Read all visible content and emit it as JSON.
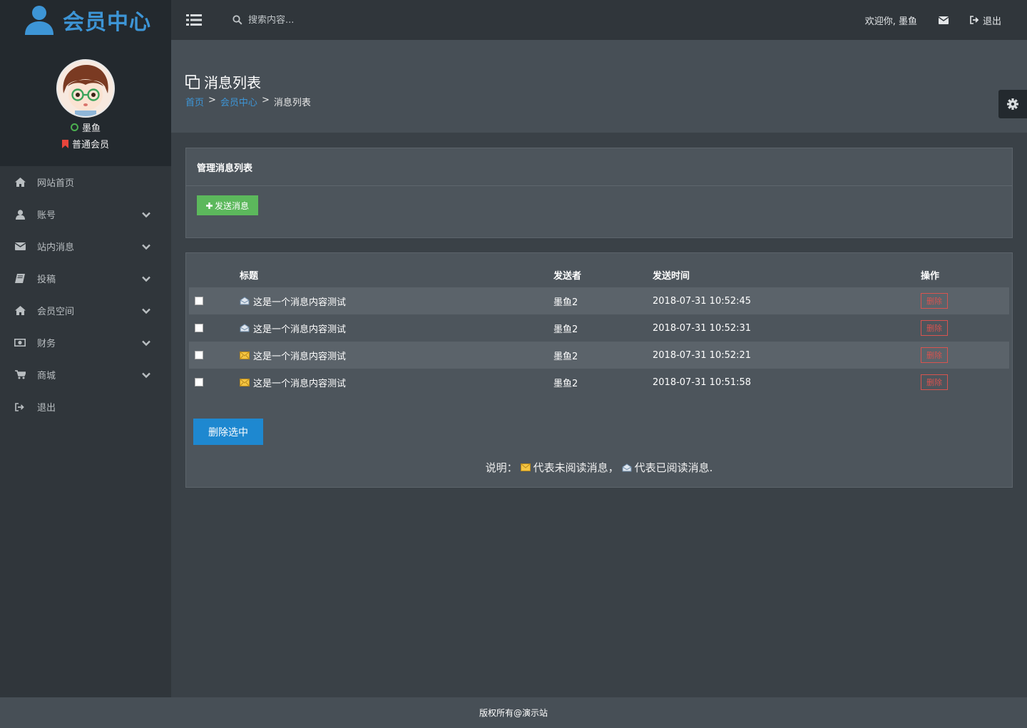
{
  "header": {
    "brand_title": "会员中心",
    "search_placeholder": "搜索内容...",
    "welcome": "欢迎你, 墨鱼",
    "logout": "退出"
  },
  "profile": {
    "name": "墨鱼",
    "level": "普通会员"
  },
  "sidebar": {
    "items": [
      {
        "label": "网站首页",
        "icon": "home-icon",
        "expandable": false
      },
      {
        "label": "账号",
        "icon": "user-icon",
        "expandable": true
      },
      {
        "label": "站内消息",
        "icon": "envelope-icon",
        "expandable": true
      },
      {
        "label": "投稿",
        "icon": "book-icon",
        "expandable": true
      },
      {
        "label": "会员空间",
        "icon": "home-icon",
        "expandable": true
      },
      {
        "label": "财务",
        "icon": "money-icon",
        "expandable": true
      },
      {
        "label": "商城",
        "icon": "cart-icon",
        "expandable": true
      },
      {
        "label": "退出",
        "icon": "sign-out-icon",
        "expandable": false
      }
    ]
  },
  "page": {
    "title": "消息列表",
    "breadcrumb": [
      "首页",
      "会员中心",
      "消息列表"
    ],
    "breadcrumb_sep": ">"
  },
  "manage_panel": {
    "title": "管理消息列表",
    "send_button": "发送消息"
  },
  "messages": {
    "columns": [
      "标题",
      "发送者",
      "发送时间",
      "操作"
    ],
    "rows": [
      {
        "title": "这是一个消息内容测试",
        "sender": "墨鱼2",
        "time": "2018-07-31 10:52:45",
        "read": true,
        "action": "删除"
      },
      {
        "title": "这是一个消息内容测试",
        "sender": "墨鱼2",
        "time": "2018-07-31 10:52:31",
        "read": true,
        "action": "删除"
      },
      {
        "title": "这是一个消息内容测试",
        "sender": "墨鱼2",
        "time": "2018-07-31 10:52:21",
        "read": false,
        "action": "删除"
      },
      {
        "title": "这是一个消息内容测试",
        "sender": "墨鱼2",
        "time": "2018-07-31 10:51:58",
        "read": false,
        "action": "删除"
      }
    ],
    "delete_selected": "删除选中",
    "legend_prefix": "说明：",
    "legend_unread": "代表未阅读消息，",
    "legend_read": "代表已阅读消息."
  },
  "footer": {
    "text": "版权所有@演示站"
  },
  "colors": {
    "brand": "#3d95d6",
    "send_button": "#5cb85c",
    "delete": "#d9534f",
    "primary": "#1e88d0"
  }
}
